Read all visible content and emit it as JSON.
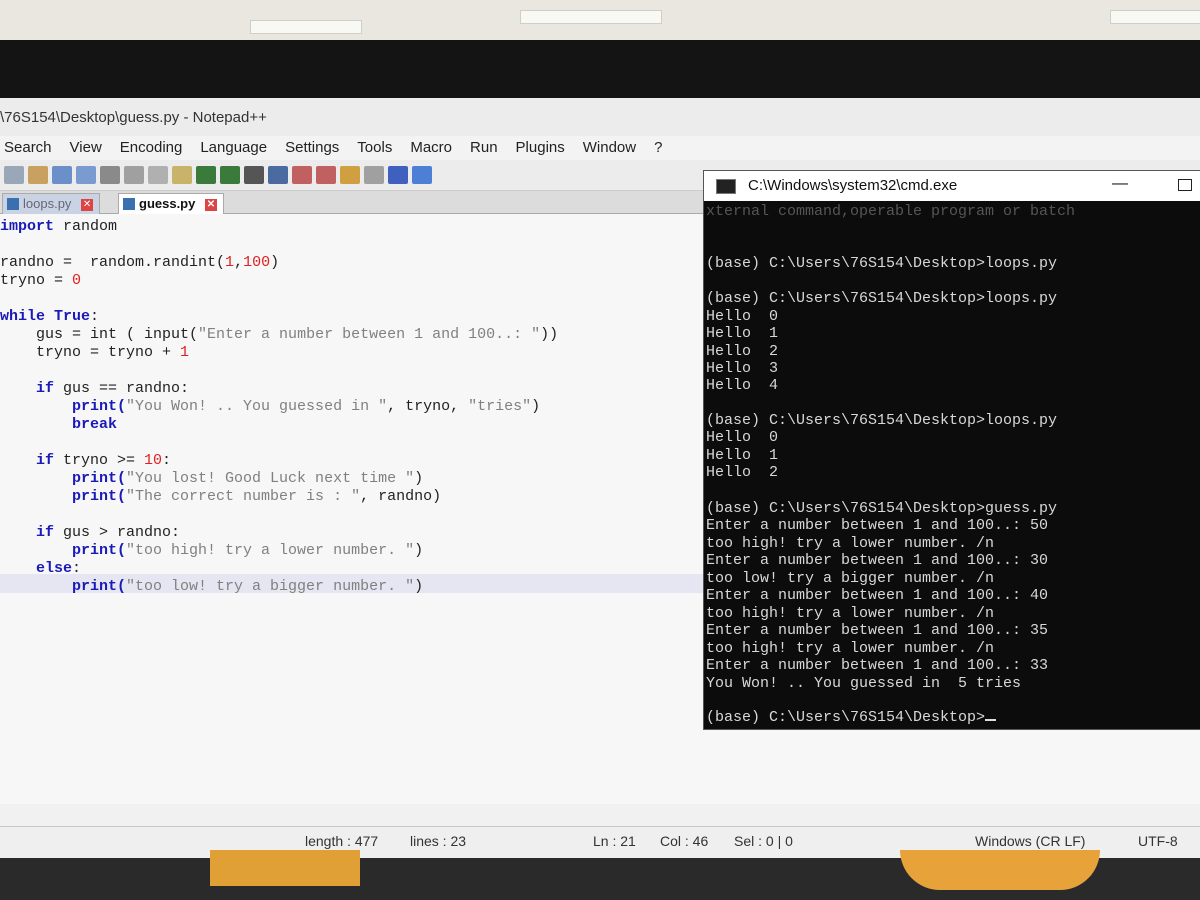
{
  "colors": {
    "keyword": "#1a1ab8",
    "number": "#e02020",
    "string": "#808080",
    "cmd_bg": "#0c0c0c"
  },
  "notepad": {
    "title": "\\76S154\\Desktop\\guess.py - Notepad++",
    "menu": [
      "Search",
      "View",
      "Encoding",
      "Language",
      "Settings",
      "Tools",
      "Macro",
      "Run",
      "Plugins",
      "Window",
      "?"
    ],
    "tabs": [
      {
        "label": "loops.py",
        "icon": "file-icon"
      },
      {
        "label": "guess.py",
        "icon": "file-icon"
      }
    ],
    "code": {
      "l1a": "import",
      "l1b": " random",
      "l2a": "randno =  random.randint(",
      "l2n1": "1",
      "l2c": ",",
      "l2n2": "100",
      "l2d": ")",
      "l3a": "tryno = ",
      "l3n": "0",
      "l4a": "while True",
      "l4b": ":",
      "l5a": "    gus = int ( input(",
      "l5s": "\"Enter a number between 1 and 100..: \"",
      "l5b": "))",
      "l6a": "    tryno = tryno + ",
      "l6n": "1",
      "l7a": "    if",
      "l7b": " gus == randno:",
      "l8a": "        print(",
      "l8s": "\"You Won! .. You guessed in \"",
      "l8b": ", tryno, ",
      "l8s2": "\"tries\"",
      "l8c": ")",
      "l9": "        break",
      "l10a": "    if",
      "l10b": " tryno >= ",
      "l10n": "10",
      "l10c": ":",
      "l11a": "        print(",
      "l11s": "\"You lost! Good Luck next time \"",
      "l11b": ")",
      "l12a": "        print(",
      "l12s": "\"The correct number is : \"",
      "l12b": ", randno)",
      "l13a": "    if",
      "l13b": " gus > randno:",
      "l14a": "        print(",
      "l14s": "\"too high! try a lower number. \"",
      "l14b": ")",
      "l15a": "    else",
      "l15b": ":",
      "l16a": "        print(",
      "l16s": "\"too low! try a bigger number. \"",
      "l16b": ")"
    },
    "status": {
      "length": "length : 477",
      "lines": "lines : 23",
      "ln": "Ln : 21",
      "col": "Col : 46",
      "sel": "Sel : 0 | 0",
      "eol": "Windows (CR LF)",
      "encoding": "UTF-8"
    }
  },
  "cmd": {
    "title": "C:\\Windows\\system32\\cmd.exe",
    "lines": [
      "xternal command,operable program or batch",
      "(base) C:\\Users\\76S154\\Desktop>loops.py",
      "(base) C:\\Users\\76S154\\Desktop>loops.py",
      "Hello  0",
      "Hello  1",
      "Hello  2",
      "Hello  3",
      "Hello  4",
      "(base) C:\\Users\\76S154\\Desktop>loops.py",
      "Hello  0",
      "Hello  1",
      "Hello  2",
      "(base) C:\\Users\\76S154\\Desktop>guess.py",
      "Enter a number between 1 and 100..: 50",
      "too high! try a lower number. /n",
      "Enter a number between 1 and 100..: 30",
      "too low! try a bigger number. /n",
      "Enter a number between 1 and 100..: 40",
      "too high! try a lower number. /n",
      "Enter a number between 1 and 100..: 35",
      "too high! try a lower number. /n",
      "Enter a number between 1 and 100..: 33",
      "You Won! .. You guessed in  5 tries",
      "(base) C:\\Users\\76S154\\Desktop>"
    ]
  }
}
